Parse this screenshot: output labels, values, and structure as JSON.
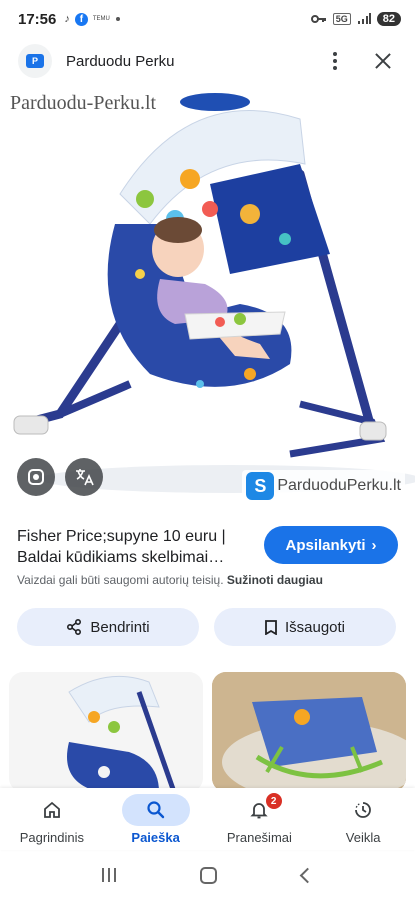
{
  "status_bar": {
    "time": "17:56",
    "temu_label": "TEMU",
    "network": "5G",
    "battery": "82"
  },
  "header": {
    "site_name": "Parduodu Perku"
  },
  "image": {
    "watermark_top": "Parduodu-Perku.lt",
    "watermark_bottom": "ParduoduPerku.lt"
  },
  "result": {
    "title": "Fisher Price;supyne 10 euru | Baldai kūdikiams skelbimai…",
    "visit_button": "Apsilankyti",
    "copyright_text": "Vaizdai gali būti saugomi autorių teisių.",
    "learn_more": "Sužinoti daugiau"
  },
  "actions": {
    "share": "Bendrinti",
    "save": "Išsaugoti"
  },
  "bottom_nav": {
    "items": [
      {
        "label": "Pagrindinis",
        "icon": "home-icon"
      },
      {
        "label": "Paieška",
        "icon": "search-icon"
      },
      {
        "label": "Pranešimai",
        "icon": "bell-icon",
        "badge": "2"
      },
      {
        "label": "Veikla",
        "icon": "activity-icon"
      }
    ],
    "active_index": 1
  },
  "colors": {
    "accent": "#1a73e8",
    "pill_bg": "#e8eefb",
    "active_nav_bg": "#d3e3fd",
    "badge": "#d93025"
  }
}
